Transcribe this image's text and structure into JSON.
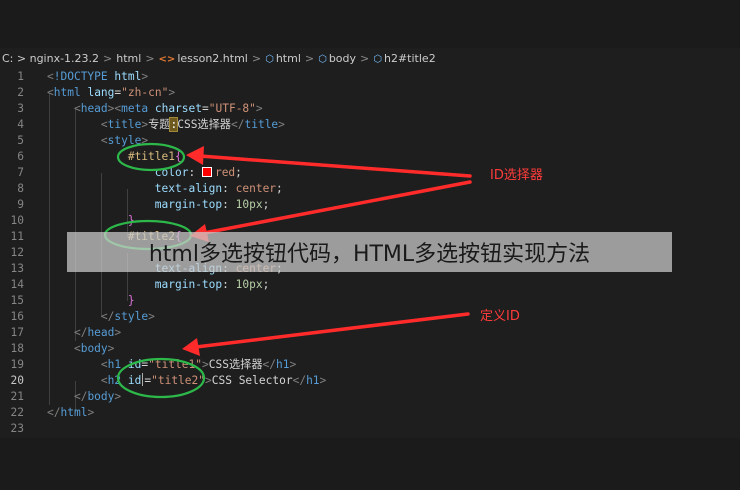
{
  "breadcrumb": {
    "items": [
      {
        "label": "C: > nginx-1.23.2",
        "icon": ""
      },
      {
        "label": "html",
        "icon": ""
      },
      {
        "label": "lesson2.html",
        "icon": "html-file-icon"
      },
      {
        "label": "html",
        "icon": "element-cube-icon"
      },
      {
        "label": "body",
        "icon": "element-cube-icon"
      },
      {
        "label": "h2#title2",
        "icon": "element-cube-icon"
      }
    ],
    "separator": ">"
  },
  "editor": {
    "active_line": 20,
    "line_numbers": [
      "1",
      "2",
      "3",
      "4",
      "5",
      "6",
      "7",
      "8",
      "9",
      "10",
      "11",
      "12",
      "13",
      "14",
      "15",
      "16",
      "17",
      "18",
      "19",
      "20",
      "21",
      "22",
      "23"
    ]
  },
  "annotations": {
    "id_selector": "ID选择器",
    "define_id": "定义ID",
    "color": "#ff2b2b",
    "circle_color": "#2db84a"
  },
  "banner": {
    "text": "html多选按钮代码，HTML多选按钮实现方法"
  },
  "colors": {
    "editor_bg": "#1e1e1e",
    "tag": "#569cd6",
    "attribute": "#9cdcfe",
    "string": "#ce9178",
    "selector": "#d7ba7d"
  }
}
